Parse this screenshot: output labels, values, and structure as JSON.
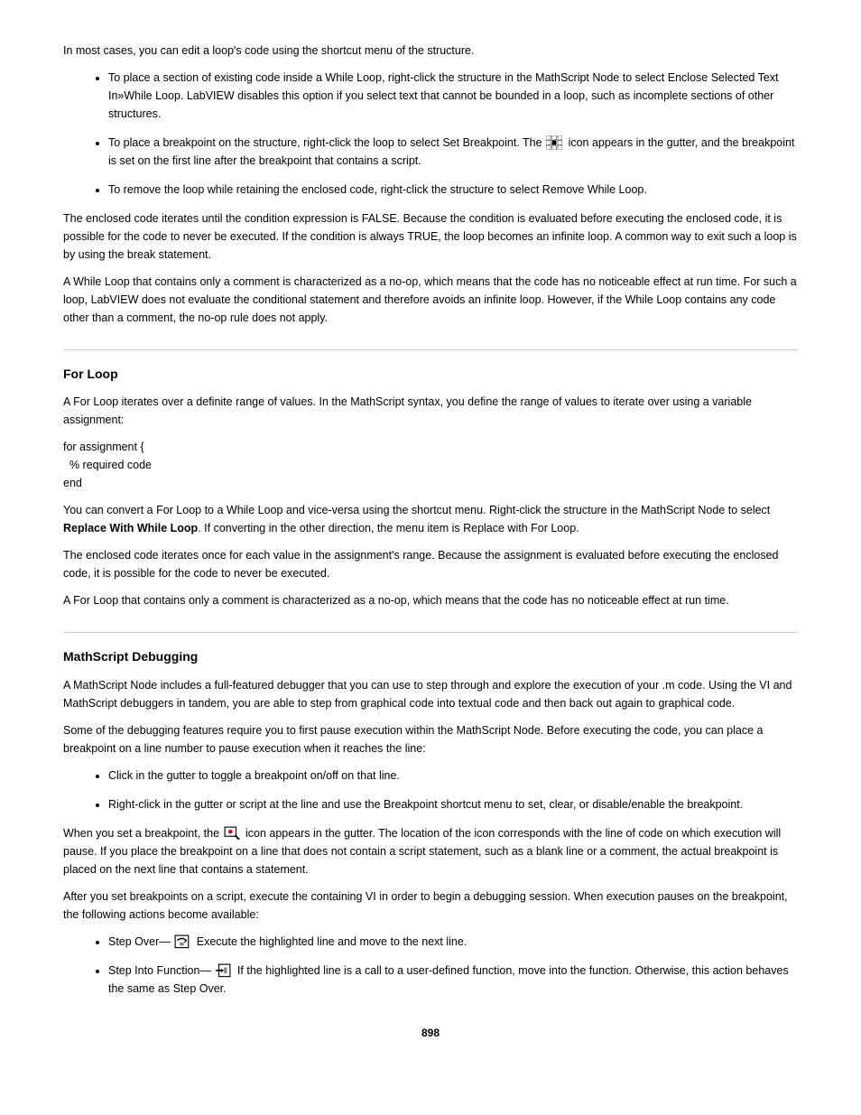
{
  "section1": {
    "intro": "In most cases, you can edit a loop's code using the shortcut menu of the structure.",
    "bullets": [
      "To place a section of existing code inside a While Loop, right-click the structure in the MathScript Node to select Enclose Selected Text In»While Loop. LabVIEW disables this option if you select text that cannot be bounded in a loop, such as incomplete sections of other structures.",
      {
        "pre": "To place a breakpoint on the structure, right-click the loop to select Set Breakpoint. The ",
        "post": " icon appears in the gutter, and the breakpoint is set on the first line after the breakpoint that contains a script."
      },
      "To remove the loop while retaining the enclosed code, right-click the structure to select Remove While Loop."
    ],
    "para1": "The enclosed code iterates until the condition expression is FALSE. Because the condition is evaluated before executing the enclosed code, it is possible for the code to never be executed. If the condition is always TRUE, the loop becomes an infinite loop. A common way to exit such a loop is by using the break statement.",
    "para2": "A While Loop that contains only a comment is characterized as a no-op, which means that the code has no noticeable effect at run time. For such a loop, LabVIEW does not evaluate the conditional statement and therefore avoids an infinite loop. However, if the While Loop contains any code other than a comment, the no-op rule does not apply."
  },
  "sec_for": {
    "title": "For Loop",
    "p1": "A For Loop iterates over a definite range of values. In the MathScript syntax, you define the range of values to iterate over using a variable assignment:",
    "code": "for assignment {\n  % required code\nend",
    "p2": {
      "pre": "You can convert a For Loop to a While Loop and vice-versa using the shortcut menu. Right-click the structure in the MathScript Node to select ",
      "bold": "Replace With While Loop",
      "post": ". If converting in the other direction, the menu item is Replace with For Loop."
    },
    "p3": "The enclosed code iterates once for each value in the assignment's range. Because the assignment is evaluated before executing the enclosed code, it is possible for the code to never be executed.",
    "p4": "A For Loop that contains only a comment is characterized as a no-op, which means that the code has no noticeable effect at run time."
  },
  "sec_debug": {
    "title": "MathScript Debugging",
    "p1": "A MathScript Node includes a full-featured debugger that you can use to step through and explore the execution of your .m code. Using the VI and MathScript debuggers in tandem, you are able to step from graphical code into textual code and then back out again to graphical code.",
    "p2": "Some of the debugging features require you to first pause execution within the MathScript Node. Before executing the code, you can place a breakpoint on a line number to pause execution when it reaches the line:",
    "bullets": [
      "Click in the gutter to toggle a breakpoint on/off on that line.",
      "Right-click in the gutter or script at the line and use the Breakpoint shortcut menu to set, clear, or disable/enable the breakpoint."
    ],
    "p3": {
      "pre": "When you set a breakpoint, the ",
      "post": " icon appears in the gutter. The location of the icon corresponds with the line of code on which execution will pause. If you place the breakpoint on a line that does not contain a script statement, such as a blank line or a comment, the actual breakpoint is placed on the next line that contains a statement."
    },
    "p4": "After you set breakpoints on a script, execute the containing VI in order to begin a debugging session. When execution pauses on the breakpoint, the following actions become available:",
    "bullets2": [
      {
        "pre": "Step Over—",
        "post": "Execute the highlighted line and move to the next line."
      },
      {
        "pre": "Step Into Function—",
        "post": "If the highlighted line is a call to a user-defined function, move into the function. Otherwise, this action behaves the same as Step Over."
      }
    ]
  },
  "page": "898"
}
